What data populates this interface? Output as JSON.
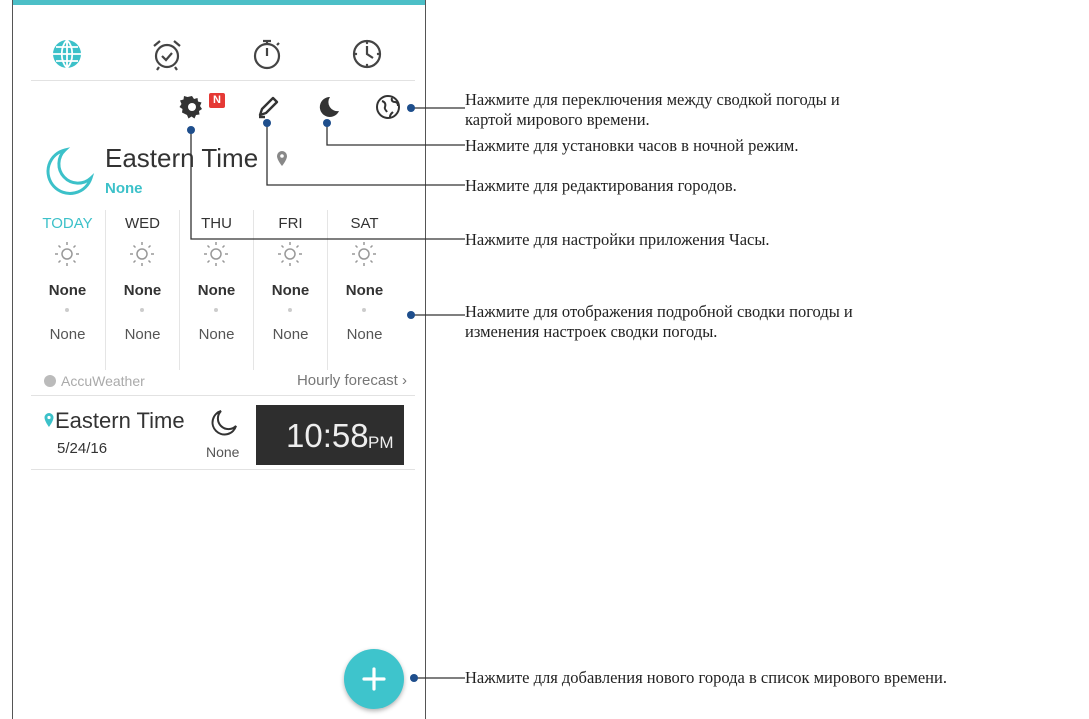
{
  "tabs": [
    {
      "icon": "world-clock-icon"
    },
    {
      "icon": "alarm-icon"
    },
    {
      "icon": "stopwatch-icon"
    },
    {
      "icon": "timer-icon"
    }
  ],
  "toolbar": {
    "settings_icon": "gear-icon",
    "badge": "N",
    "edit_icon": "pencil-icon",
    "night_icon": "moon-icon",
    "map_icon": "globe-icon"
  },
  "city": {
    "name": "Eastern Time",
    "condition": "None"
  },
  "forecast": [
    {
      "day": "TODAY",
      "high": "None",
      "low": "None"
    },
    {
      "day": "WED",
      "high": "None",
      "low": "None"
    },
    {
      "day": "THU",
      "high": "None",
      "low": "None"
    },
    {
      "day": "FRI",
      "high": "None",
      "low": "None"
    },
    {
      "day": "SAT",
      "high": "None",
      "low": "None"
    }
  ],
  "accuweather": "AccuWeather",
  "hourly_forecast": "Hourly forecast",
  "world_clock": {
    "city": "Eastern Time",
    "date": "5/24/16",
    "condition": "None",
    "time": "10:58",
    "ampm": "PM"
  },
  "callouts": {
    "toggle_line1": "Нажмите для переключения между сводкой погоды и",
    "toggle_line2": "картой мирового времени.",
    "night": "Нажмите для установки часов в ночной режим.",
    "edit": "Нажмите для редактирования городов.",
    "settings": "Нажмите для настройки приложения Часы.",
    "weather_line1": "Нажмите для отображения подробной сводки погоды и",
    "weather_line2": "изменения настроек сводки погоды.",
    "add": "Нажмите для добавления нового города в список мирового времени."
  },
  "colors": {
    "accent": "#3cc1c9",
    "clock_bg": "#2e2e2e",
    "badge": "#e53935"
  }
}
